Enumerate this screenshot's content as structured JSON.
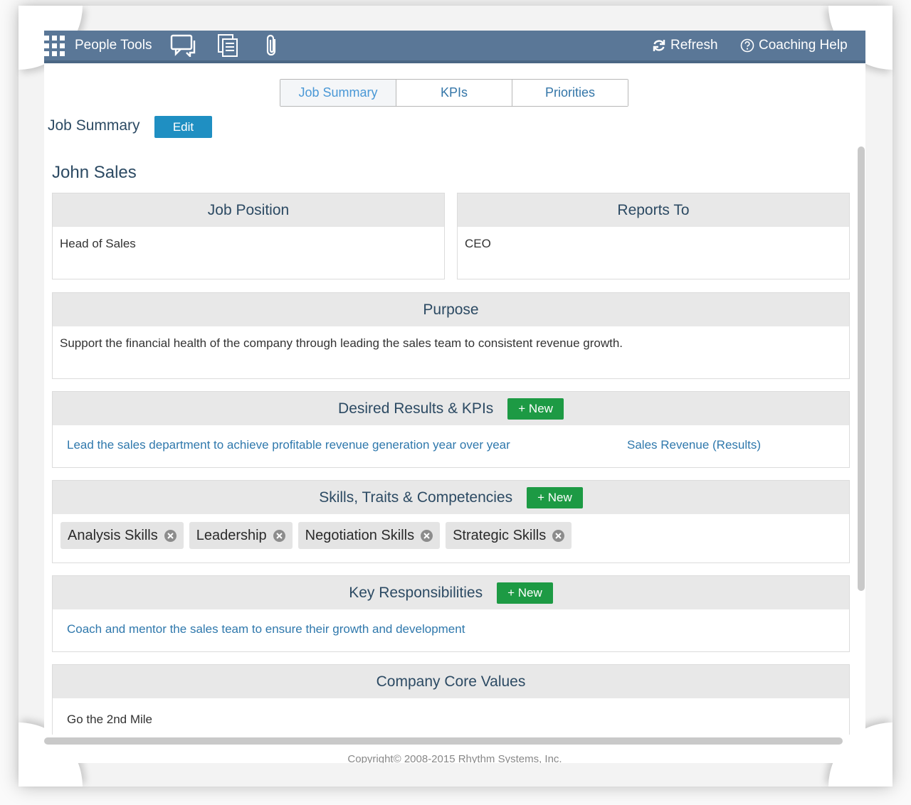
{
  "nav": {
    "title": "People Tools",
    "icons": [
      "apps-grid-icon",
      "chat-icon",
      "documents-icon",
      "paperclip-icon"
    ],
    "refresh_label": "Refresh",
    "help_label": "Coaching Help"
  },
  "tabs": [
    {
      "label": "Job Summary",
      "active": true
    },
    {
      "label": "KPIs",
      "active": false
    },
    {
      "label": "Priorities",
      "active": false
    }
  ],
  "page": {
    "title": "Job Summary",
    "edit_label": "Edit",
    "person_name": "John Sales"
  },
  "job_position": {
    "header": "Job Position",
    "value": "Head of Sales"
  },
  "reports_to": {
    "header": "Reports To",
    "value": "CEO"
  },
  "purpose": {
    "header": "Purpose",
    "value": "Support the financial health of the company through leading the sales team to consistent revenue growth."
  },
  "desired_results": {
    "header": "Desired Results & KPIs",
    "new_label": "+ New",
    "items": [
      {
        "text": "Lead the sales department to achieve profitable revenue generation year over year",
        "kpi": "Sales Revenue (Results)"
      }
    ]
  },
  "skills": {
    "header": "Skills, Traits & Competencies",
    "new_label": "+ New",
    "items": [
      "Analysis Skills",
      "Leadership",
      "Negotiation Skills",
      "Strategic Skills"
    ]
  },
  "responsibilities": {
    "header": "Key Responsibilities",
    "new_label": "+ New",
    "items": [
      "Coach and mentor the sales team to ensure their growth and development"
    ]
  },
  "core_values": {
    "header": "Company Core Values",
    "items": [
      "Go the 2nd Mile"
    ]
  },
  "footer": "Copyright© 2008-2015 Rhythm Systems, Inc.",
  "colors": {
    "navbar": "#5a7797",
    "edit_button": "#1f8fc2",
    "new_button": "#1d9a44",
    "link": "#2f78ac",
    "header_bg": "#e8e8e8"
  }
}
